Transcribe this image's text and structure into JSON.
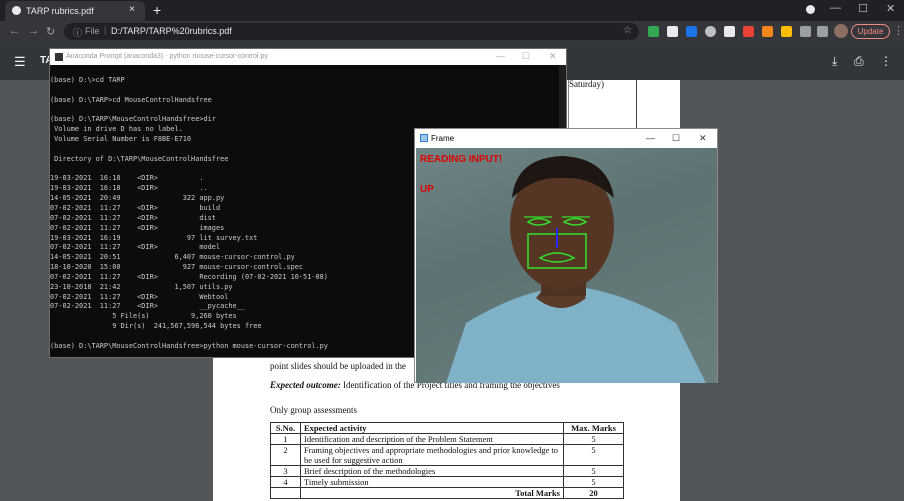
{
  "browser": {
    "tab_title": "TARP rubrics.pdf",
    "new_tab": "+",
    "tab_close": "×",
    "url_label": "File",
    "url": "D:/TARP/TARP%20rubrics.pdf",
    "update_label": "Update"
  },
  "pdf": {
    "filename": "TA",
    "page_lines": {
      "saturday": "Saturday)",
      "point_slides": "point slides should be uploaded in the",
      "expected_label": "Expected outcome:",
      "expected_text": "Identification of the Project titles and framing the objectives",
      "only_group": "Only group assessments"
    },
    "table": {
      "headers": [
        "S.No.",
        "Expected activity",
        "Max. Marks"
      ],
      "rows": [
        {
          "no": "1",
          "activity": "Identification and description of the Problem Statement",
          "marks": "5"
        },
        {
          "no": "2",
          "activity": "Framing objectives and appropriate methodologies and prior knowledge to be used for suggestive action",
          "marks": "5"
        },
        {
          "no": "3",
          "activity": "Brief description of the methodologies",
          "marks": "5"
        },
        {
          "no": "4",
          "activity": "Timely submission",
          "marks": "5"
        }
      ],
      "total_label": "Total Marks",
      "total_value": "20"
    }
  },
  "cmd": {
    "title": "Anaconda Prompt (anaconda3) - python  mouse-cursor-control.py",
    "lines": [
      "(base) D:\\>cd TARP",
      "",
      "(base) D:\\TARP>cd MouseControlHandsfree",
      "",
      "(base) D:\\TARP\\MouseControlHandsfree>dir",
      " Volume in drive D has no label.",
      " Volume Serial Number is F8BE-E710",
      "",
      " Directory of D:\\TARP\\MouseControlHandsfree",
      "",
      "19-03-2021  16:18    <DIR>          .",
      "19-03-2021  16:18    <DIR>          ..",
      "14-05-2021  20:49               322 app.py",
      "07-02-2021  11:27    <DIR>          build",
      "07-02-2021  11:27    <DIR>          dist",
      "07-02-2021  11:27    <DIR>          images",
      "19-03-2021  16:19                97 lit survey.txt",
      "07-02-2021  11:27    <DIR>          model",
      "14-05-2021  20:51             6,407 mouse-cursor-control.py",
      "18-10-2020  15:00               927 mouse-cursor-control.spec",
      "07-02-2021  11:27    <DIR>          Recording (07-02-2021 10-51-08)",
      "23-10-2018  21:42             1,507 utils.py",
      "07-02-2021  11:27    <DIR>          Webtool",
      "07-02-2021  11:27    <DIR>          __pycache__",
      "               5 File(s)          9,260 bytes",
      "               9 Dir(s)  241,567,596,544 bytes free",
      "",
      "(base) D:\\TARP\\MouseControlHandsfree>python mouse-cursor-control.py"
    ]
  },
  "frame": {
    "title": "Frame",
    "status_reading": "READING INPUT!",
    "status_direction": "UP"
  },
  "window_controls": {
    "minimize": "—",
    "maximize": "☐",
    "close": "✕"
  }
}
